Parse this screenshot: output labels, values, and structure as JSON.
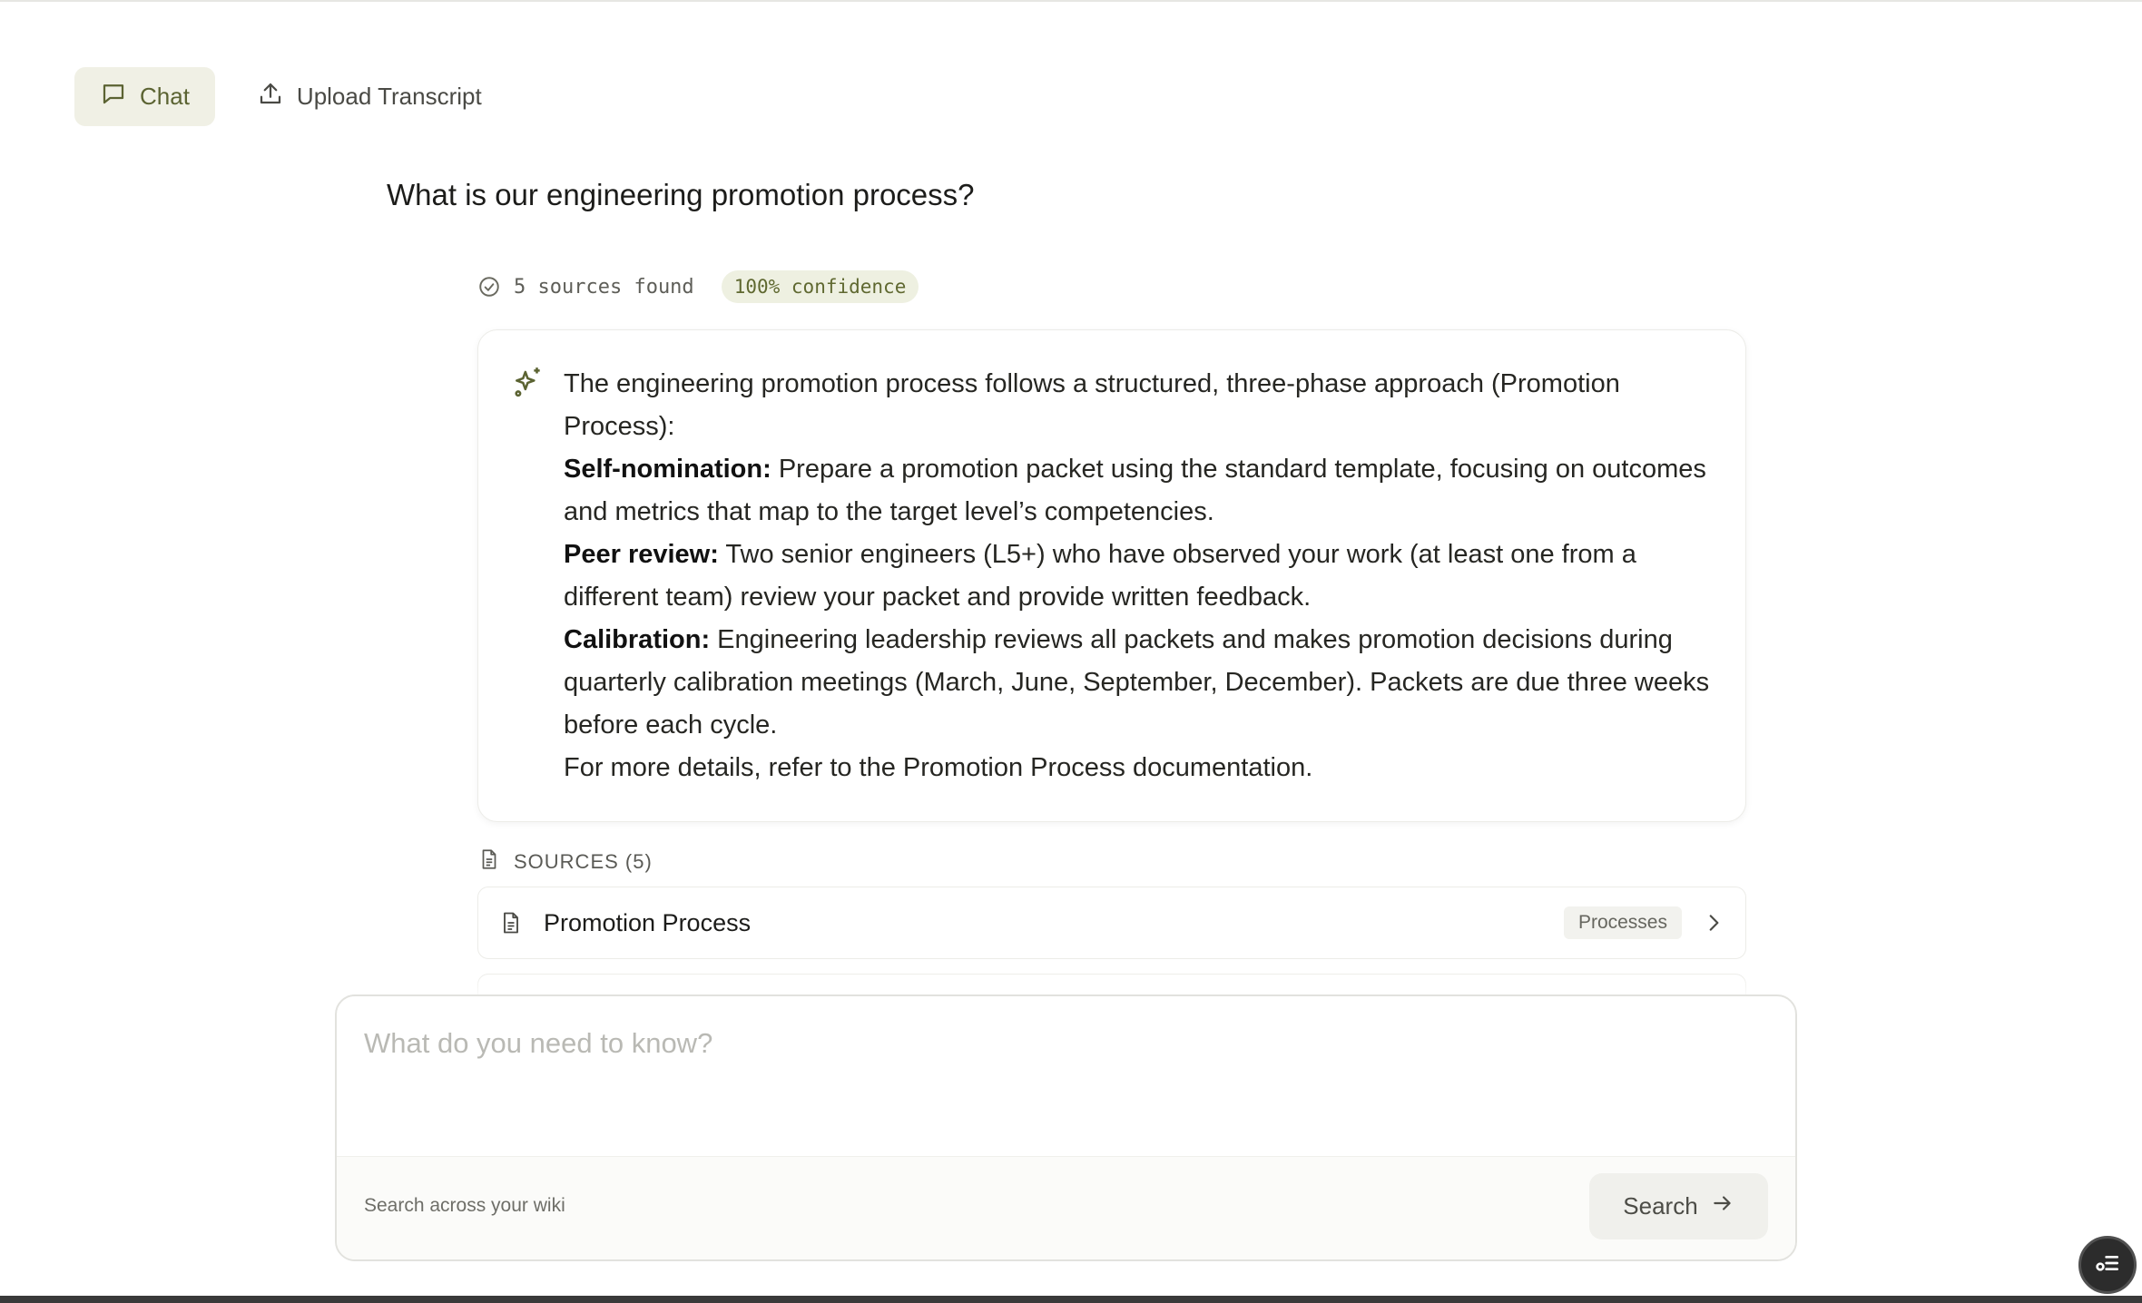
{
  "tabs": [
    {
      "label": "Chat",
      "icon": "chat-bubble-icon",
      "active": true
    },
    {
      "label": "Upload Transcript",
      "icon": "upload-icon",
      "active": false
    }
  ],
  "question": "What is our engineering promotion process?",
  "meta": {
    "sources_found": "5 sources found",
    "confidence": "100% confidence"
  },
  "answer": {
    "intro": "The engineering promotion process follows a structured, three-phase approach (Promotion Process):",
    "steps": [
      {
        "label": "Self-nomination:",
        "text": " Prepare a promotion packet using the standard template, focusing on outcomes and metrics that map to the target level’s competencies."
      },
      {
        "label": "Peer review:",
        "text": " Two senior engineers (L5+) who have observed your work (at least one from a different team) review your packet and provide written feedback."
      },
      {
        "label": "Calibration:",
        "text": " Engineering leadership reviews all packets and makes promotion decisions during quarterly calibration meetings (March, June, September, December). Packets are due three weeks before each cycle."
      }
    ],
    "outro": "For more details, refer to the Promotion Process documentation."
  },
  "sources": {
    "header": "SOURCES (5)",
    "items": [
      {
        "title": "Promotion Process",
        "tag": "Processes"
      }
    ]
  },
  "input": {
    "placeholder": "What do you need to know?",
    "hint": "Search across your wiki",
    "button_label": "Search"
  },
  "colors": {
    "accent": "#5b6332",
    "tab_active_bg": "#f0f0e5",
    "confidence_bg": "#eef0e1"
  }
}
